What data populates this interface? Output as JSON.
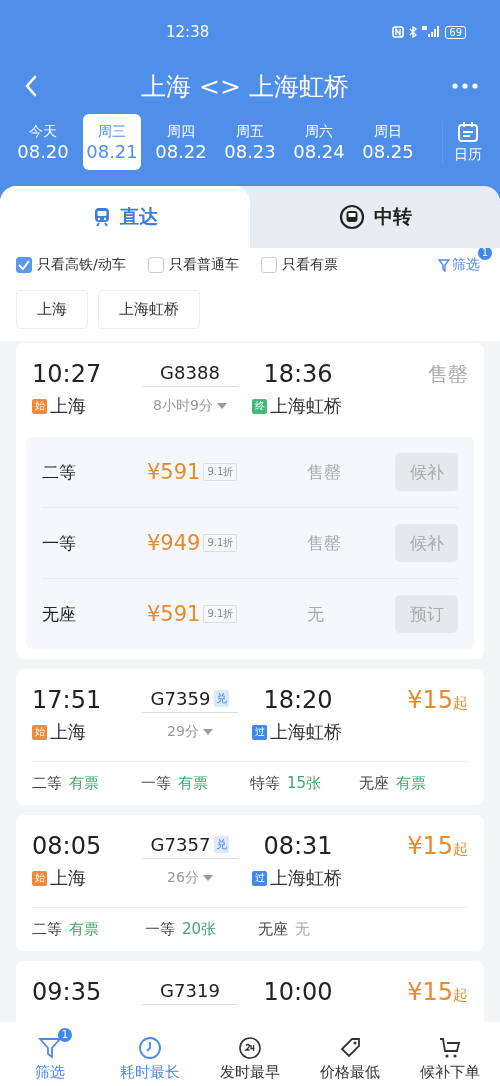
{
  "status_bar": {
    "time": "12:38",
    "battery": "69"
  },
  "header": {
    "title": "上海 <> 上海虹桥"
  },
  "dates": [
    {
      "weekday": "今天",
      "date": "08.20",
      "selected": false
    },
    {
      "weekday": "周三",
      "date": "08.21",
      "selected": true
    },
    {
      "weekday": "周四",
      "date": "08.22",
      "selected": false
    },
    {
      "weekday": "周五",
      "date": "08.23",
      "selected": false
    },
    {
      "weekday": "周六",
      "date": "08.24",
      "selected": false
    },
    {
      "weekday": "周日",
      "date": "08.25",
      "selected": false
    }
  ],
  "calendar": {
    "label": "日历"
  },
  "mode_tabs": [
    {
      "label": "直达",
      "selected": true
    },
    {
      "label": "中转",
      "selected": false
    }
  ],
  "filters": [
    {
      "label": "只看高铁/动车",
      "checked": true
    },
    {
      "label": "只看普通车",
      "checked": false
    },
    {
      "label": "只看有票",
      "checked": false
    }
  ],
  "filter_button": {
    "label": "筛选",
    "badge": "1"
  },
  "station_chips": [
    "上海",
    "上海虹桥"
  ],
  "trains": [
    {
      "kind": "expanded",
      "depart": "10:27",
      "origin": {
        "tag": "始",
        "name": "上海",
        "color": "#ee8a3a"
      },
      "number": "G8388",
      "duration": "8小时9分",
      "arrive": "18:36",
      "destination": {
        "tag": "终",
        "name": "上海虹桥",
        "color": "#3fba78"
      },
      "status": "售罄",
      "seat_rows": [
        {
          "class": "二等",
          "price": "¥591",
          "discount": "9.1折",
          "availability": "售罄",
          "action": "候补"
        },
        {
          "class": "一等",
          "price": "¥949",
          "discount": "9.1折",
          "availability": "售罄",
          "action": "候补"
        },
        {
          "class": "无座",
          "price": "¥591",
          "discount": "9.1折",
          "availability": "无",
          "action": "预订"
        }
      ]
    },
    {
      "kind": "summary",
      "depart": "17:51",
      "origin": {
        "tag": "始",
        "name": "上海",
        "color": "#ee8a3a"
      },
      "number": "G7359",
      "badge": "兑",
      "duration": "29分",
      "arrive": "18:20",
      "destination": {
        "tag": "过",
        "name": "上海虹桥",
        "color": "#3f8ae8"
      },
      "price": "¥15",
      "price_suffix": "起",
      "seats": [
        {
          "class": "二等",
          "availability": "有票",
          "available": true
        },
        {
          "class": "一等",
          "availability": "有票",
          "available": true
        },
        {
          "class": "特等",
          "availability": "15张",
          "available": true
        },
        {
          "class": "无座",
          "availability": "有票",
          "available": true
        }
      ]
    },
    {
      "kind": "summary",
      "depart": "08:05",
      "origin": {
        "tag": "始",
        "name": "上海",
        "color": "#ee8a3a"
      },
      "number": "G7357",
      "badge": "兑",
      "duration": "26分",
      "arrive": "08:31",
      "destination": {
        "tag": "过",
        "name": "上海虹桥",
        "color": "#3f8ae8"
      },
      "price": "¥15",
      "price_suffix": "起",
      "seats": [
        {
          "class": "二等",
          "availability": "有票",
          "available": true
        },
        {
          "class": "一等",
          "availability": "20张",
          "available": true
        },
        {
          "class": "无座",
          "availability": "无",
          "available": false
        }
      ]
    },
    {
      "kind": "partial",
      "depart": "09:35",
      "number": "G7319",
      "arrive": "10:00",
      "price": "¥15",
      "price_suffix": "起"
    }
  ],
  "bottom_nav": [
    {
      "label": "筛选",
      "badge": "1",
      "selected": true
    },
    {
      "label": "耗时最长",
      "selected": true
    },
    {
      "label": "发时最早",
      "selected": false
    },
    {
      "label": "价格最低",
      "selected": false
    },
    {
      "label": "候补下单",
      "selected": false
    }
  ]
}
